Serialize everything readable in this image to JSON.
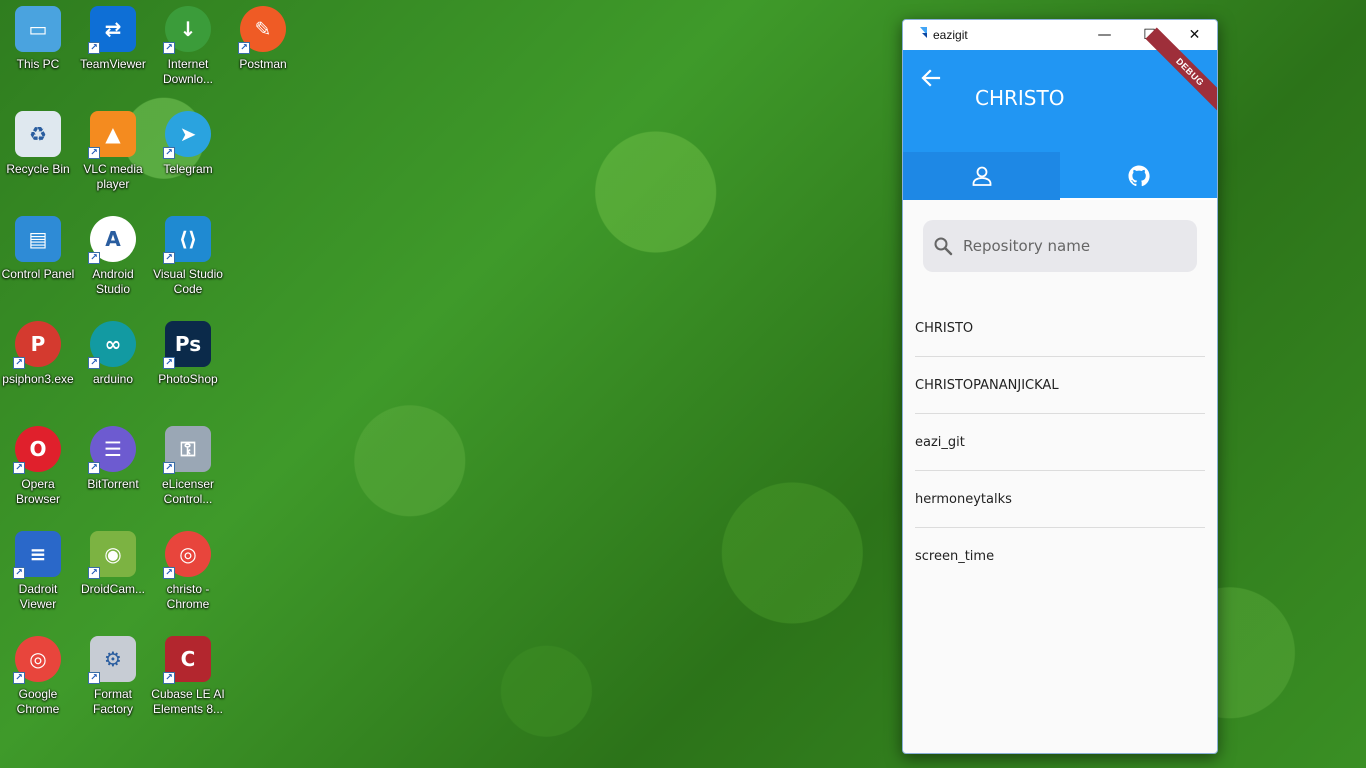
{
  "desktop": {
    "icons": [
      {
        "label": "This PC",
        "color": "#4aa3df",
        "glyph": "▭"
      },
      {
        "label": "TeamViewer",
        "color": "#0e6fd6",
        "glyph": "⇄"
      },
      {
        "label": "Internet Downlo...",
        "color": "#3b9c3a",
        "glyph": "↓"
      },
      {
        "label": "Postman",
        "color": "#ef5b25",
        "glyph": "✎"
      },
      {
        "label": "Recycle Bin",
        "color": "#dfe8ef",
        "glyph": "♻"
      },
      {
        "label": "VLC media player",
        "color": "#f48b1f",
        "glyph": "▲"
      },
      {
        "label": "Telegram",
        "color": "#2aa3df",
        "glyph": "➤"
      },
      {
        "label": "Control Panel",
        "color": "#2e8bd6",
        "glyph": "▤"
      },
      {
        "label": "Android Studio",
        "color": "#ffffff",
        "glyph": "A"
      },
      {
        "label": "Visual Studio Code",
        "color": "#1f8ad2",
        "glyph": "⟨⟩"
      },
      {
        "label": "psiphon3.exe",
        "color": "#d43a2f",
        "glyph": "P"
      },
      {
        "label": "arduino",
        "color": "#129aa2",
        "glyph": "∞"
      },
      {
        "label": "PhotoShop",
        "color": "#0b2a4a",
        "glyph": "Ps"
      },
      {
        "label": "Opera Browser",
        "color": "#e0202c",
        "glyph": "O"
      },
      {
        "label": "BitTorrent",
        "color": "#6d5bd0",
        "glyph": "☰"
      },
      {
        "label": "eLicenser Control...",
        "color": "#9aa7b5",
        "glyph": "⚿"
      },
      {
        "label": "Dadroit Viewer",
        "color": "#2a68c9",
        "glyph": "≡"
      },
      {
        "label": "DroidCam...",
        "color": "#7cb342",
        "glyph": "◉"
      },
      {
        "label": "christo - Chrome",
        "color": "#e8453c",
        "glyph": "◎"
      },
      {
        "label": "Google Chrome",
        "color": "#e8453c",
        "glyph": "◎"
      },
      {
        "label": "Format Factory",
        "color": "#c7ccd4",
        "glyph": "⚙"
      },
      {
        "label": "Cubase LE AI Elements 8...",
        "color": "#b3262e",
        "glyph": "C"
      }
    ]
  },
  "window": {
    "title": "eazigit",
    "minimize": "—",
    "maximize": "☐",
    "close": "✕"
  },
  "app": {
    "title": "CHRISTO",
    "debug_banner": "DEBUG",
    "accent": "#2196f3",
    "tabs": [
      {
        "icon": "person-icon"
      },
      {
        "icon": "github-icon"
      }
    ],
    "search": {
      "placeholder": "Repository name",
      "value": ""
    },
    "repos": [
      "CHRISTO",
      "CHRISTOPANANJICKAL",
      "eazi_git",
      "hermoneytalks",
      "screen_time"
    ]
  }
}
